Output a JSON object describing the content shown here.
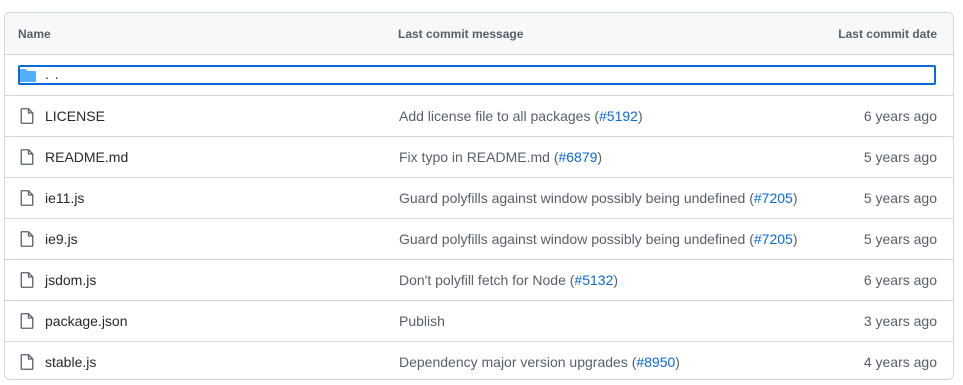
{
  "header": {
    "name": "Name",
    "message": "Last commit message",
    "date": "Last commit date"
  },
  "parent": {
    "label": ". ."
  },
  "files": [
    {
      "name": "LICENSE",
      "msg_before": "Add license file to all packages (",
      "pr": "#5192",
      "msg_after": ")",
      "date": "6 years ago"
    },
    {
      "name": "README.md",
      "msg_before": "Fix typo in README.md (",
      "pr": "#6879",
      "msg_after": ")",
      "date": "5 years ago"
    },
    {
      "name": "ie11.js",
      "msg_before": "Guard polyfills against window possibly being undefined (",
      "pr": "#7205",
      "msg_after": ")",
      "date": "5 years ago"
    },
    {
      "name": "ie9.js",
      "msg_before": "Guard polyfills against window possibly being undefined (",
      "pr": "#7205",
      "msg_after": ")",
      "date": "5 years ago"
    },
    {
      "name": "jsdom.js",
      "msg_before": "Don't polyfill fetch for Node (",
      "pr": "#5132",
      "msg_after": ")",
      "date": "6 years ago"
    },
    {
      "name": "package.json",
      "msg_before": "Publish",
      "pr": "",
      "msg_after": "",
      "date": "3 years ago"
    },
    {
      "name": "stable.js",
      "msg_before": "Dependency major version upgrades (",
      "pr": "#8950",
      "msg_after": ")",
      "date": "4 years ago"
    }
  ],
  "colors": {
    "link": "#0969da",
    "folder": "#54aeff",
    "border": "#d0d7de"
  },
  "icons": {
    "parent": "folder-icon",
    "file": "file-icon"
  }
}
